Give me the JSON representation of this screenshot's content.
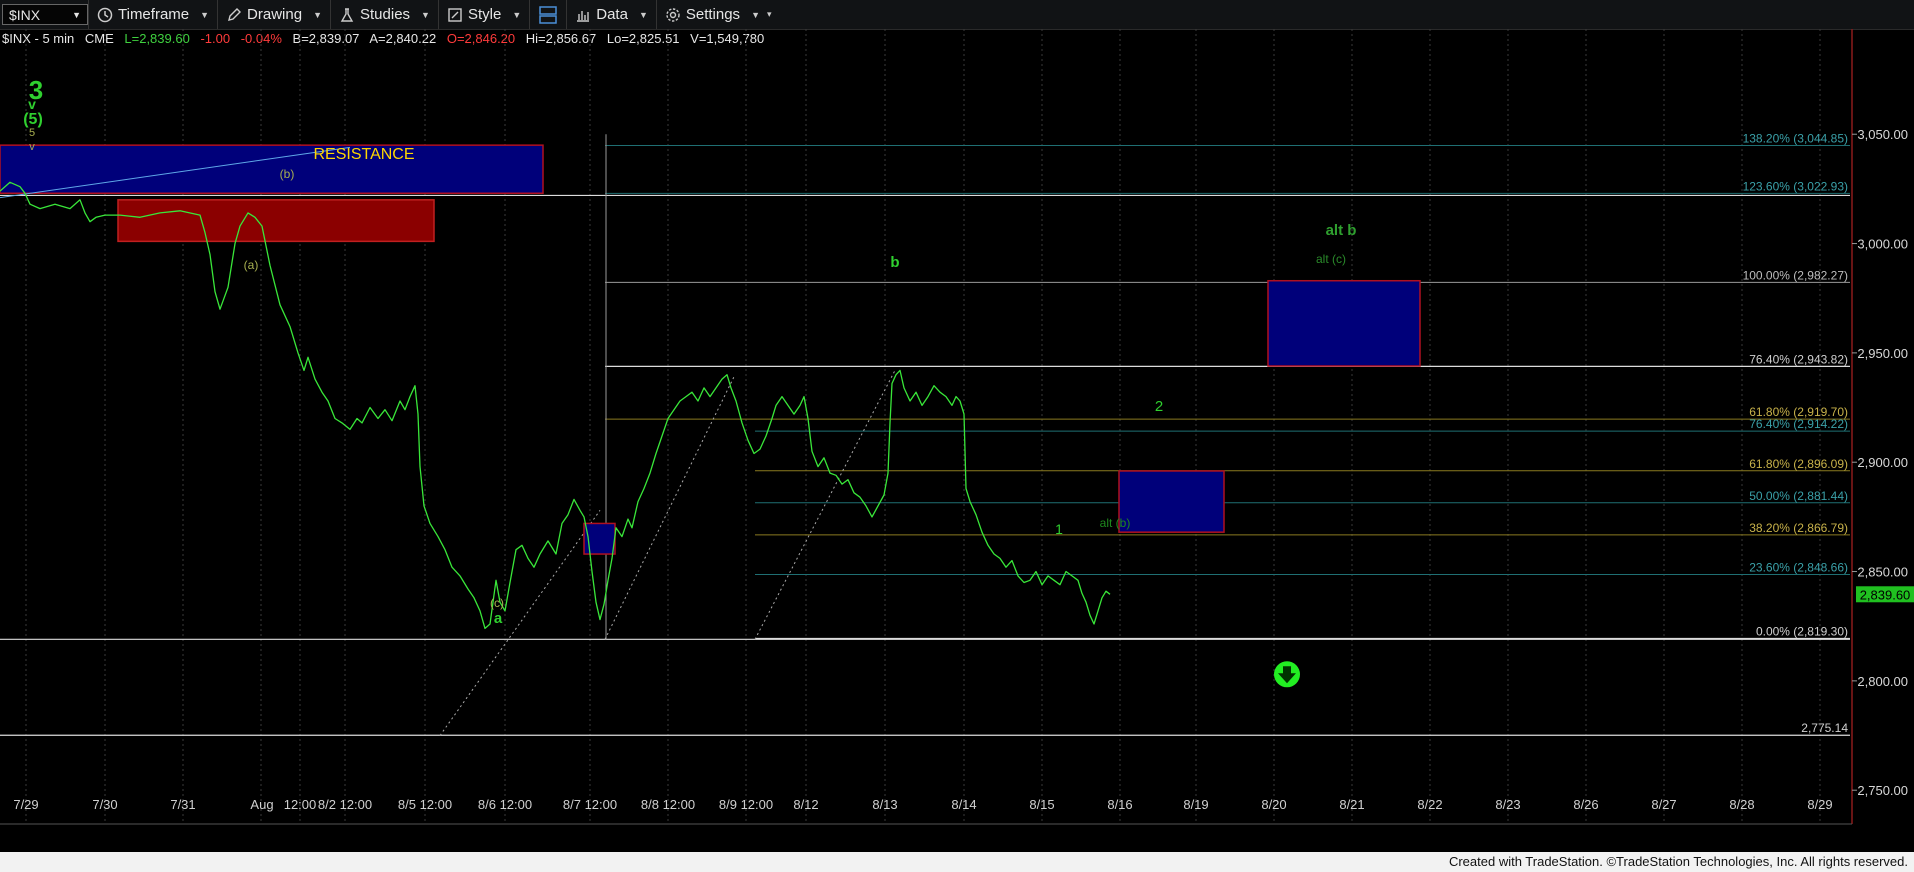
{
  "toolbar": {
    "symbol": "$INX",
    "buttons": [
      {
        "label": "Timeframe",
        "icon": "clock-icon"
      },
      {
        "label": "Drawing",
        "icon": "pencil-icon"
      },
      {
        "label": "Studies",
        "icon": "studies-icon"
      },
      {
        "label": "Style",
        "icon": "style-icon"
      },
      {
        "label": "",
        "icon": "layout-icon"
      },
      {
        "label": "Data",
        "icon": "data-icon"
      },
      {
        "label": "Settings",
        "icon": "gear-icon"
      }
    ]
  },
  "quote": {
    "title": "$INX - 5 min",
    "exchange": "CME",
    "last": "L=2,839.60",
    "change": "-1.00",
    "change_pct": "-0.04%",
    "bid": "B=2,839.07",
    "ask": "A=2,840.22",
    "open": "O=2,846.20",
    "high": "Hi=2,856.67",
    "low": "Lo=2,825.51",
    "volume": "V=1,549,780"
  },
  "chart_data": {
    "type": "line",
    "x_ticks": [
      "7/29",
      "7/30",
      "7/31",
      "Aug",
      "12:00",
      "8/2 12:00",
      "8/5 12:00",
      "8/6 12:00",
      "8/7 12:00",
      "8/8 12:00",
      "8/9 12:00",
      "8/12",
      "8/13",
      "8/14",
      "8/15",
      "8/16",
      "8/19",
      "8/20",
      "8/21",
      "8/22",
      "8/23",
      "8/26",
      "8/27",
      "8/28",
      "8/29"
    ],
    "y_ticks": [
      "3,050.00",
      "3,000.00",
      "2,950.00",
      "2,900.00",
      "2,850.00",
      "2,800.00",
      "2,750.00"
    ],
    "y_range": [
      2735,
      3078
    ],
    "last_price_label": "2,839.60",
    "last_price": 2839.6,
    "series": [
      {
        "points": [
          [
            0,
            3024
          ],
          [
            10,
            3028
          ],
          [
            20,
            3026
          ],
          [
            25,
            3023
          ],
          [
            30,
            3018
          ],
          [
            40,
            3016
          ],
          [
            55,
            3018
          ],
          [
            70,
            3016
          ],
          [
            80,
            3020
          ],
          [
            85,
            3014
          ],
          [
            90,
            3010
          ],
          [
            96,
            3012
          ],
          [
            105,
            3013
          ],
          [
            120,
            3013
          ],
          [
            140,
            3012
          ],
          [
            160,
            3014
          ],
          [
            180,
            3015
          ],
          [
            200,
            3013
          ],
          [
            205,
            3005
          ],
          [
            210,
            2995
          ],
          [
            215,
            2978
          ],
          [
            220,
            2970
          ],
          [
            228,
            2980
          ],
          [
            235,
            3000
          ],
          [
            240,
            3008
          ],
          [
            248,
            3014
          ],
          [
            255,
            3012
          ],
          [
            262,
            3008
          ],
          [
            270,
            2990
          ],
          [
            280,
            2972
          ],
          [
            290,
            2962
          ],
          [
            298,
            2950
          ],
          [
            304,
            2942
          ],
          [
            308,
            2948
          ],
          [
            315,
            2938
          ],
          [
            322,
            2932
          ],
          [
            328,
            2928
          ],
          [
            335,
            2920
          ],
          [
            342,
            2918
          ],
          [
            350,
            2915
          ],
          [
            357,
            2920
          ],
          [
            362,
            2918
          ],
          [
            370,
            2925
          ],
          [
            378,
            2920
          ],
          [
            385,
            2924
          ],
          [
            392,
            2919
          ],
          [
            400,
            2928
          ],
          [
            405,
            2924
          ],
          [
            410,
            2930
          ],
          [
            415,
            2935
          ],
          [
            418,
            2922
          ],
          [
            420,
            2898
          ],
          [
            424,
            2880
          ],
          [
            430,
            2872
          ],
          [
            438,
            2866
          ],
          [
            445,
            2860
          ],
          [
            452,
            2852
          ],
          [
            460,
            2848
          ],
          [
            468,
            2842
          ],
          [
            474,
            2838
          ],
          [
            480,
            2832
          ],
          [
            485,
            2824
          ],
          [
            490,
            2826
          ],
          [
            496,
            2846
          ],
          [
            500,
            2836
          ],
          [
            505,
            2832
          ],
          [
            510,
            2845
          ],
          [
            516,
            2860
          ],
          [
            522,
            2862
          ],
          [
            528,
            2856
          ],
          [
            534,
            2852
          ],
          [
            540,
            2858
          ],
          [
            548,
            2864
          ],
          [
            556,
            2858
          ],
          [
            562,
            2872
          ],
          [
            568,
            2876
          ],
          [
            574,
            2883
          ],
          [
            580,
            2878
          ],
          [
            584,
            2875
          ],
          [
            588,
            2866
          ],
          [
            592,
            2850
          ],
          [
            596,
            2836
          ],
          [
            600,
            2828
          ],
          [
            604,
            2835
          ],
          [
            608,
            2846
          ],
          [
            612,
            2856
          ],
          [
            616,
            2870
          ],
          [
            622,
            2866
          ],
          [
            628,
            2874
          ],
          [
            632,
            2870
          ],
          [
            638,
            2882
          ],
          [
            644,
            2888
          ],
          [
            650,
            2895
          ],
          [
            656,
            2904
          ],
          [
            662,
            2912
          ],
          [
            668,
            2920
          ],
          [
            674,
            2924
          ],
          [
            680,
            2928
          ],
          [
            686,
            2930
          ],
          [
            692,
            2932
          ],
          [
            698,
            2928
          ],
          [
            704,
            2934
          ],
          [
            710,
            2930
          ],
          [
            716,
            2934
          ],
          [
            722,
            2938
          ],
          [
            727,
            2940
          ],
          [
            731,
            2934
          ],
          [
            736,
            2928
          ],
          [
            742,
            2918
          ],
          [
            748,
            2910
          ],
          [
            754,
            2904
          ],
          [
            760,
            2906
          ],
          [
            766,
            2912
          ],
          [
            772,
            2920
          ],
          [
            776,
            2926
          ],
          [
            782,
            2930
          ],
          [
            788,
            2926
          ],
          [
            794,
            2922
          ],
          [
            800,
            2926
          ],
          [
            804,
            2930
          ],
          [
            808,
            2920
          ],
          [
            812,
            2905
          ],
          [
            818,
            2898
          ],
          [
            824,
            2902
          ],
          [
            830,
            2895
          ],
          [
            836,
            2894
          ],
          [
            842,
            2890
          ],
          [
            848,
            2892
          ],
          [
            854,
            2886
          ],
          [
            860,
            2884
          ],
          [
            866,
            2880
          ],
          [
            872,
            2875
          ],
          [
            878,
            2880
          ],
          [
            884,
            2885
          ],
          [
            888,
            2895
          ],
          [
            890,
            2918
          ],
          [
            892,
            2936
          ],
          [
            896,
            2940
          ],
          [
            900,
            2942
          ],
          [
            904,
            2934
          ],
          [
            910,
            2928
          ],
          [
            916,
            2932
          ],
          [
            922,
            2926
          ],
          [
            928,
            2930
          ],
          [
            934,
            2935
          ],
          [
            940,
            2932
          ],
          [
            946,
            2930
          ],
          [
            952,
            2926
          ],
          [
            956,
            2930
          ],
          [
            960,
            2928
          ],
          [
            964,
            2922
          ],
          [
            966,
            2888
          ],
          [
            970,
            2882
          ],
          [
            976,
            2876
          ],
          [
            982,
            2868
          ],
          [
            988,
            2862
          ],
          [
            994,
            2858
          ],
          [
            1000,
            2856
          ],
          [
            1006,
            2852
          ],
          [
            1012,
            2855
          ],
          [
            1018,
            2848
          ],
          [
            1024,
            2845
          ],
          [
            1030,
            2846
          ],
          [
            1036,
            2850
          ],
          [
            1042,
            2844
          ],
          [
            1048,
            2848
          ],
          [
            1054,
            2846
          ],
          [
            1060,
            2844
          ],
          [
            1066,
            2850
          ],
          [
            1072,
            2848
          ],
          [
            1078,
            2846
          ],
          [
            1082,
            2840
          ],
          [
            1086,
            2836
          ],
          [
            1090,
            2830
          ],
          [
            1094,
            2826
          ],
          [
            1098,
            2832
          ],
          [
            1102,
            2838
          ],
          [
            1106,
            2841
          ],
          [
            1110,
            2839.6
          ]
        ]
      }
    ],
    "fib_levels": [
      {
        "label": "138.20% (3,044.85)",
        "value": 3044.85
      },
      {
        "label": "123.60% (3,022.93)",
        "value": 3022.93
      },
      {
        "label": "100.00% (2,982.27)",
        "value": 2982.27
      },
      {
        "label": "76.40% (2,943.82)",
        "value": 2943.82
      },
      {
        "label": "61.80% (2,919.70)",
        "value": 2919.7
      },
      {
        "label": "76.40% (2,914.22)",
        "value": 2914.22
      },
      {
        "label": "61.80% (2,896.09)",
        "value": 2896.09
      },
      {
        "label": "50.00% (2,881.44)",
        "value": 2881.44
      },
      {
        "label": "38.20% (2,866.79)",
        "value": 2866.79
      },
      {
        "label": "23.60% (2,848.66)",
        "value": 2848.66
      },
      {
        "label": "0.00% (2,819.30)",
        "value": 2819.3
      },
      {
        "label": "2,775.14",
        "value": 2775.14
      }
    ],
    "annotations": {
      "resistance": "RESISTANCE",
      "wave_3": "3",
      "wave_5_paren": "(5)",
      "wave_5": "5",
      "wave_v": "v",
      "wave_a_paren": "(a)",
      "wave_b_paren": "(b)",
      "wave_c_paren": "(c)",
      "wave_a": "a",
      "wave_b": "b",
      "wave_1": "1",
      "alt_b_paren": "alt (b)",
      "wave_2": "2",
      "alt_b": "alt b",
      "alt_c": "alt (c)"
    },
    "colors": {
      "price": "#39e639",
      "box_blue": "#00007a",
      "box_red": "#8b0000",
      "resistance_text": "#ffd700",
      "fib_teal": "#1f6f73",
      "fib_gold": "#8a7a20",
      "label_teal": "#3aa0a8",
      "label_gold": "#c8b24a"
    }
  },
  "footer": {
    "text": "Created with TradeStation. ©TradeStation Technologies, Inc. All rights reserved."
  }
}
